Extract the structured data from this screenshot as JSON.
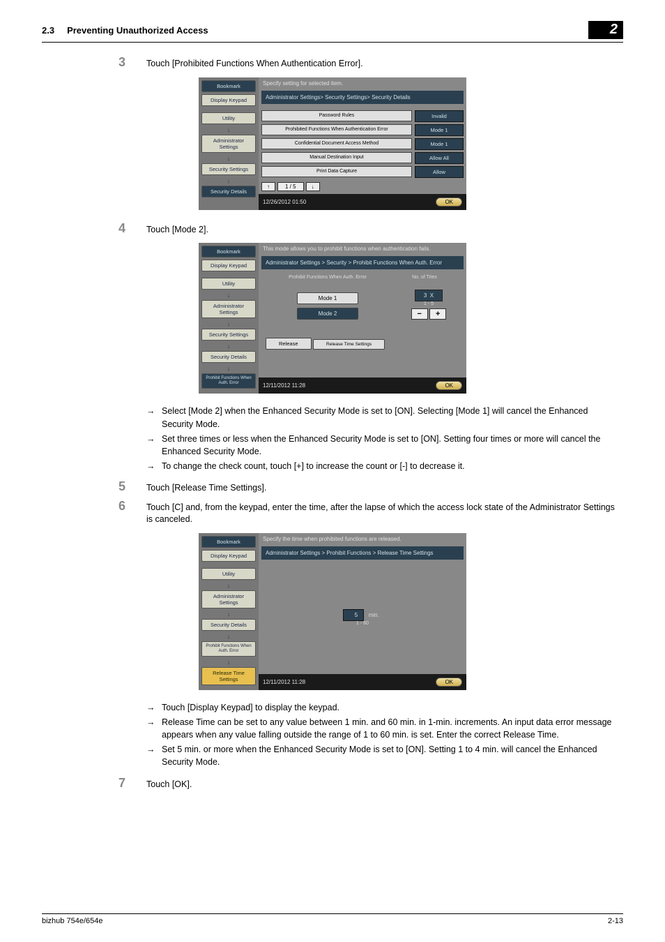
{
  "header": {
    "section_no": "2.3",
    "section_title": "Preventing Unauthorized Access",
    "chapter": "2"
  },
  "steps": {
    "s3": {
      "num": "3",
      "text": "Touch [Prohibited Functions When Authentication Error]."
    },
    "s4": {
      "num": "4",
      "text": "Touch [Mode 2]."
    },
    "s5": {
      "num": "5",
      "text": "Touch [Release Time Settings]."
    },
    "s6": {
      "num": "6",
      "text": "Touch [C] and, from the keypad, enter the time, after the lapse of which the access lock state of the Administrator Settings is canceled."
    },
    "s7": {
      "num": "7",
      "text": "Touch [OK]."
    }
  },
  "bullets1": {
    "b1": "Select [Mode 2] when the Enhanced Security Mode is set to [ON]. Selecting [Mode 1] will cancel the Enhanced Security Mode.",
    "b2": "Set three times or less when the Enhanced Security Mode is set to [ON]. Setting four times or more will cancel the Enhanced Security Mode.",
    "b3": "To change the check count, touch [+] to increase the count or [-] to decrease it."
  },
  "bullets2": {
    "b1": "Touch [Display Keypad] to display the keypad.",
    "b2": "Release Time can be set to any value between 1 min. and 60 min. in 1-min. increments. An input data error message appears when any value falling outside the range of 1 to 60 min. is set. Enter the correct Release Time.",
    "b3": "Set 5 min. or more when the Enhanced Security Mode is set to [ON]. Setting 1 to 4 min. will cancel the Enhanced Security Mode."
  },
  "shot1": {
    "top": "Specify setting for selected item.",
    "crumb": "Administrator Settings> Security Settings> Security Details",
    "side": {
      "bookmark": "Bookmark",
      "display": "Display Keypad",
      "util": "Utility",
      "admin": "Administrator\nSettings",
      "sec": "Security\nSettings",
      "details": "Security Details"
    },
    "rows": {
      "r1l": "Password Rules",
      "r1v": "Invalid",
      "r2l": "Prohibited Functions When Authentication Error",
      "r2v": "Mode 1",
      "r3l": "Confidential Document Access Method",
      "r3v": "Mode 1",
      "r4l": "Manual Destination Input",
      "r4v": "Allow All",
      "r5l": "Print Data Capture",
      "r5v": "Allow"
    },
    "pager": "1 / 5",
    "status": "12/26/2012   01:50",
    "ok": "OK"
  },
  "shot2": {
    "top": "This mode allows you to prohibit functions when authentication fails.",
    "crumb": "Administrator Settings > Security > Prohibit Functions When Auth. Error",
    "side": {
      "bookmark": "Bookmark",
      "display": "Display Keypad",
      "util": "Utility",
      "admin": "Administrator\nSettings",
      "sec": "Security\nSettings",
      "details": "Security Details",
      "pf": "Prohibit Functions When Auth. Error"
    },
    "hdr_l": "Prohibit Functions When Auth. Error",
    "hdr_r": "No. of Tries",
    "mode1": "Mode 1",
    "mode2": "Mode 2",
    "tries_val": "3",
    "tries_x": "X",
    "tries_range": "1 - 5",
    "release": "Release",
    "release_time": "Release Time Settings",
    "status": "12/11/2012   11:28",
    "ok": "OK"
  },
  "shot3": {
    "top": "Specify the time when prohibited functions are released.",
    "crumb": "Administrator Settings > Prohibit Functions > Release Time Settings",
    "side": {
      "bookmark": "Bookmark",
      "display": "Display Keypad",
      "util": "Utility",
      "admin": "Administrator\nSettings",
      "details": "Security Details",
      "pf": "Prohibit Functions When Auth. Error",
      "rt": "Release Time\nSettings"
    },
    "min_val": "5",
    "min_lbl": "min.",
    "range": "1 - 60",
    "status": "12/11/2012   11:28",
    "ok": "OK"
  },
  "footer": {
    "left": "bizhub 754e/654e",
    "right": "2-13"
  }
}
